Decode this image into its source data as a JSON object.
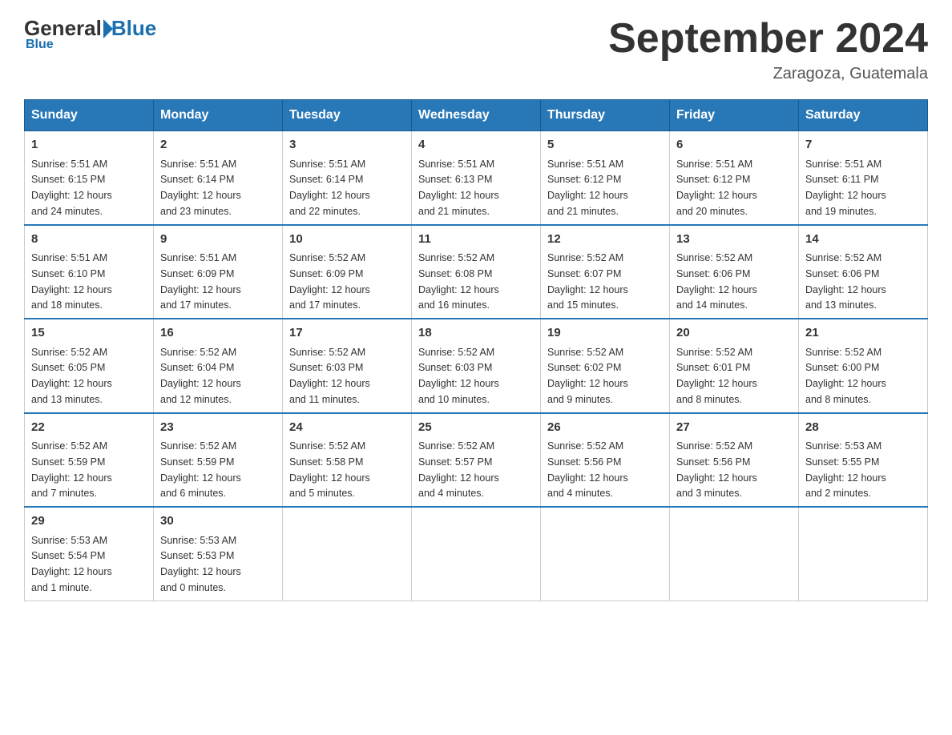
{
  "header": {
    "logo": {
      "general": "General",
      "blue": "Blue"
    },
    "title": "September 2024",
    "location": "Zaragoza, Guatemala"
  },
  "weekdays": [
    "Sunday",
    "Monday",
    "Tuesday",
    "Wednesday",
    "Thursday",
    "Friday",
    "Saturday"
  ],
  "weeks": [
    [
      {
        "day": "1",
        "sunrise": "5:51 AM",
        "sunset": "6:15 PM",
        "daylight": "12 hours and 24 minutes."
      },
      {
        "day": "2",
        "sunrise": "5:51 AM",
        "sunset": "6:14 PM",
        "daylight": "12 hours and 23 minutes."
      },
      {
        "day": "3",
        "sunrise": "5:51 AM",
        "sunset": "6:14 PM",
        "daylight": "12 hours and 22 minutes."
      },
      {
        "day": "4",
        "sunrise": "5:51 AM",
        "sunset": "6:13 PM",
        "daylight": "12 hours and 21 minutes."
      },
      {
        "day": "5",
        "sunrise": "5:51 AM",
        "sunset": "6:12 PM",
        "daylight": "12 hours and 21 minutes."
      },
      {
        "day": "6",
        "sunrise": "5:51 AM",
        "sunset": "6:12 PM",
        "daylight": "12 hours and 20 minutes."
      },
      {
        "day": "7",
        "sunrise": "5:51 AM",
        "sunset": "6:11 PM",
        "daylight": "12 hours and 19 minutes."
      }
    ],
    [
      {
        "day": "8",
        "sunrise": "5:51 AM",
        "sunset": "6:10 PM",
        "daylight": "12 hours and 18 minutes."
      },
      {
        "day": "9",
        "sunrise": "5:51 AM",
        "sunset": "6:09 PM",
        "daylight": "12 hours and 17 minutes."
      },
      {
        "day": "10",
        "sunrise": "5:52 AM",
        "sunset": "6:09 PM",
        "daylight": "12 hours and 17 minutes."
      },
      {
        "day": "11",
        "sunrise": "5:52 AM",
        "sunset": "6:08 PM",
        "daylight": "12 hours and 16 minutes."
      },
      {
        "day": "12",
        "sunrise": "5:52 AM",
        "sunset": "6:07 PM",
        "daylight": "12 hours and 15 minutes."
      },
      {
        "day": "13",
        "sunrise": "5:52 AM",
        "sunset": "6:06 PM",
        "daylight": "12 hours and 14 minutes."
      },
      {
        "day": "14",
        "sunrise": "5:52 AM",
        "sunset": "6:06 PM",
        "daylight": "12 hours and 13 minutes."
      }
    ],
    [
      {
        "day": "15",
        "sunrise": "5:52 AM",
        "sunset": "6:05 PM",
        "daylight": "12 hours and 13 minutes."
      },
      {
        "day": "16",
        "sunrise": "5:52 AM",
        "sunset": "6:04 PM",
        "daylight": "12 hours and 12 minutes."
      },
      {
        "day": "17",
        "sunrise": "5:52 AM",
        "sunset": "6:03 PM",
        "daylight": "12 hours and 11 minutes."
      },
      {
        "day": "18",
        "sunrise": "5:52 AM",
        "sunset": "6:03 PM",
        "daylight": "12 hours and 10 minutes."
      },
      {
        "day": "19",
        "sunrise": "5:52 AM",
        "sunset": "6:02 PM",
        "daylight": "12 hours and 9 minutes."
      },
      {
        "day": "20",
        "sunrise": "5:52 AM",
        "sunset": "6:01 PM",
        "daylight": "12 hours and 8 minutes."
      },
      {
        "day": "21",
        "sunrise": "5:52 AM",
        "sunset": "6:00 PM",
        "daylight": "12 hours and 8 minutes."
      }
    ],
    [
      {
        "day": "22",
        "sunrise": "5:52 AM",
        "sunset": "5:59 PM",
        "daylight": "12 hours and 7 minutes."
      },
      {
        "day": "23",
        "sunrise": "5:52 AM",
        "sunset": "5:59 PM",
        "daylight": "12 hours and 6 minutes."
      },
      {
        "day": "24",
        "sunrise": "5:52 AM",
        "sunset": "5:58 PM",
        "daylight": "12 hours and 5 minutes."
      },
      {
        "day": "25",
        "sunrise": "5:52 AM",
        "sunset": "5:57 PM",
        "daylight": "12 hours and 4 minutes."
      },
      {
        "day": "26",
        "sunrise": "5:52 AM",
        "sunset": "5:56 PM",
        "daylight": "12 hours and 4 minutes."
      },
      {
        "day": "27",
        "sunrise": "5:52 AM",
        "sunset": "5:56 PM",
        "daylight": "12 hours and 3 minutes."
      },
      {
        "day": "28",
        "sunrise": "5:53 AM",
        "sunset": "5:55 PM",
        "daylight": "12 hours and 2 minutes."
      }
    ],
    [
      {
        "day": "29",
        "sunrise": "5:53 AM",
        "sunset": "5:54 PM",
        "daylight": "12 hours and 1 minute."
      },
      {
        "day": "30",
        "sunrise": "5:53 AM",
        "sunset": "5:53 PM",
        "daylight": "12 hours and 0 minutes."
      },
      null,
      null,
      null,
      null,
      null
    ]
  ],
  "labels": {
    "sunrise": "Sunrise:",
    "sunset": "Sunset:",
    "daylight": "Daylight:"
  }
}
